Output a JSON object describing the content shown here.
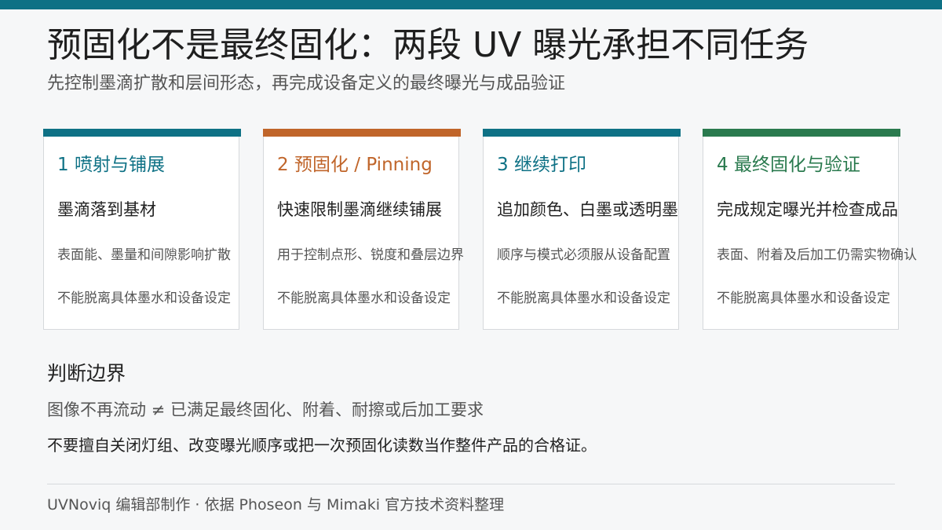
{
  "colors": {
    "top_bar": "#0e7185",
    "step1": "#0e7185",
    "step2": "#c0652a",
    "step3": "#0e7185",
    "step4": "#2a7a4e"
  },
  "header": {
    "title": "预固化不是最终固化：两段 UV 曝光承担不同任务",
    "subtitle": "先控制墨滴扩散和层间形态，再完成设备定义的最终曝光与成品验证"
  },
  "cards": [
    {
      "heading": "1  喷射与铺展",
      "main": "墨滴落到基材",
      "line1": "表面能、墨量和间隙影响扩散",
      "line2": "不能脱离具体墨水和设备设定"
    },
    {
      "heading": "2  预固化 / Pinning",
      "main": "快速限制墨滴继续铺展",
      "line1": "用于控制点形、锐度和叠层边界",
      "line2": "不能脱离具体墨水和设备设定"
    },
    {
      "heading": "3  继续打印",
      "main": "追加颜色、白墨或透明墨",
      "line1": "顺序与模式必须服从设备配置",
      "line2": "不能脱离具体墨水和设备设定"
    },
    {
      "heading": "4  最终固化与验证",
      "main": "完成规定曝光并检查成品",
      "line1": "表面、附着及后加工仍需实物确认",
      "line2": "不能脱离具体墨水和设备设定"
    }
  ],
  "judgement": {
    "title": "判断边界",
    "line1": "图像不再流动 ≠ 已满足最终固化、附着、耐擦或后加工要求",
    "line2": "不要擅自关闭灯组、改变曝光顺序或把一次预固化读数当作整件产品的合格证。"
  },
  "footer": {
    "text": "UVNoviq 编辑部制作 · 依据 Phoseon 与 Mimaki 官方技术资料整理"
  }
}
